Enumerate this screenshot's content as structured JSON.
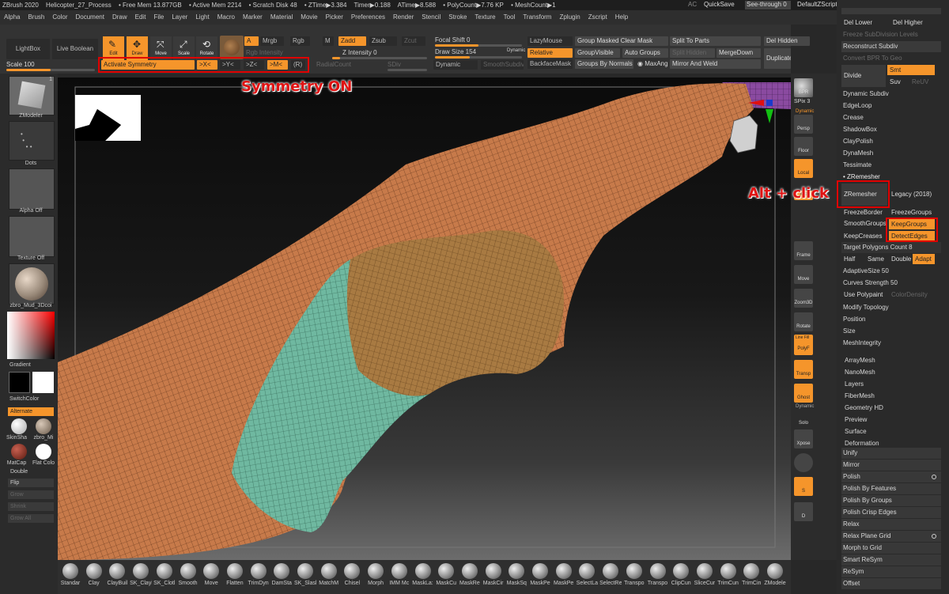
{
  "titlebar": {
    "items": [
      "ZBrush 2020",
      "Helicopter_27_Process",
      "• Free Mem 13.877GB",
      "• Active Mem 2214",
      "• Scratch Disk 48",
      "• ZTime▶3.384",
      "Timer▶0.188",
      "ATime▶8.588",
      "• PolyCount▶7.76 KP",
      "• MeshCount▶1"
    ],
    "ac": "AC",
    "quicksave": "QuickSave",
    "seethrough": "See-through  0",
    "defaultzscript": "DefaultZScript"
  },
  "menu": [
    "Alpha",
    "Brush",
    "Color",
    "Document",
    "Draw",
    "Edit",
    "File",
    "Layer",
    "Light",
    "Macro",
    "Marker",
    "Material",
    "Movie",
    "Picker",
    "Preferences",
    "Render",
    "Stencil",
    "Stroke",
    "Texture",
    "Tool",
    "Transform",
    "Zplugin",
    "Zscript",
    "Help"
  ],
  "shelf": {
    "lightbox": "LightBox",
    "liveboolean": "Live Boolean",
    "edit": "Edit",
    "draw": "Draw",
    "move": "Move",
    "scale": "Scale 100",
    "rotate": "Rotate",
    "a": "A",
    "mrgb": "Mrgb",
    "rgb": "Rgb",
    "m": "M",
    "zadd": "Zadd",
    "zsub": "Zsub",
    "zcut": "Zcut",
    "rgb_intensity": "Rgb Intensity",
    "z_intensity": "Z Intensity 0",
    "focal_shift": "Focal Shift 0",
    "draw_size": "Draw Size 154",
    "dynamic_label": "Dynamic",
    "dynamic": "Dynamic",
    "smoothsubdiv": "SmoothSubdiv",
    "activate_symmetry": "Activate Symmetry",
    "x": ">X<",
    "y": ">Y<",
    "z": ">Z<",
    "m_sym": ">M<",
    "r": "(R)",
    "radialcount": "RadialCount",
    "sdiv": "SDiv",
    "lazymouse": "LazyMouse",
    "relative": "Relative",
    "backfacemask": "BackfaceMask",
    "group_masked_clear_mask": "Group Masked Clear Mask",
    "groupvisible": "GroupVisible",
    "auto_groups": "Auto Groups",
    "groups_by_normals": "Groups By Normals",
    "maxang": "MaxAng",
    "mirror_and_weld": "Mirror And Weld",
    "split_to_parts": "Split To Parts",
    "split_hidden": "Split Hidden",
    "mergedown": "MergeDown",
    "del_hidden": "Del Hidden",
    "duplicate": "Duplicate"
  },
  "leftpanel": {
    "zmodeler": "ZModeler",
    "zmodeler_count": "1",
    "dots": "Dots",
    "alpha_off": "Alpha Off",
    "texture_off": "Texture Off",
    "material": "zbro_Mud_3Dcoi",
    "gradient": "Gradient",
    "switchcolor": "SwitchColor",
    "alternate": "Alternate",
    "skinshade": "SkinSha",
    "zbro_mi": "zbro_Mi",
    "matcap": "MatCap",
    "flat_color": "Flat Colo",
    "double": "Double",
    "flip": "Flip",
    "grow": "Grow",
    "shrink": "Shrink",
    "grow_all": "Grow All"
  },
  "annotations": {
    "symmetry": "Symmetry ON",
    "altclick": "Alt + click"
  },
  "righttools": {
    "bpr": "BPR",
    "spix": "SPix 3",
    "dynamic": "Dynamic",
    "persp": "Persp",
    "floor": "Floor",
    "local": "Local",
    "xyz": "Xyz",
    "frame": "Frame",
    "move": "Move",
    "zoom3d": "Zoom3D",
    "rotate": "Rotate",
    "linefill": "Line Fill",
    "polyf": "PolyF",
    "transp": "Transp",
    "ghost": "Ghost",
    "dynamic2": "Dynamic",
    "solo": "Solo",
    "xpose": "Xpose",
    "s": "S",
    "d": "D"
  },
  "rightpanel": {
    "top1": "Del Lower",
    "top2": "Del Higher",
    "freeze_subdiv": "Freeze SubDivision Levels",
    "reconstruct": "Reconstruct Subdiv",
    "convert_bpr": "Convert BPR To Geo",
    "divide": "Divide",
    "smt": "Smt",
    "suv": "Suv",
    "reuv": "ReUV",
    "dynamic_subdiv": "Dynamic Subdiv",
    "edgeloop": "EdgeLoop",
    "crease": "Crease",
    "shadowbox": "ShadowBox",
    "claypolish": "ClayPolish",
    "dynamesh": "DynaMesh",
    "tessimate": "Tessimate",
    "zremesher_header": "ZRemesher",
    "zremesher": "ZRemesher",
    "legacy": "Legacy (2018)",
    "freezeborder": "FreezeBorder",
    "freezegroups": "FreezeGroups",
    "smoothgroups": "SmoothGroups",
    "keepgroups": "KeepGroups",
    "keepcreases": "KeepCreases",
    "detectedges": "DetectEdges",
    "target_polygons": "Target Polygons Count 8",
    "half": "Half",
    "same": "Same",
    "double": "Double",
    "adapt": "Adapt",
    "adaptivesize": "AdaptiveSize 50",
    "curves_strength": "Curves Strength 50",
    "use_polypaint": "Use Polypaint",
    "colordensity": "ColorDensity",
    "modify_topology": "Modify Topology",
    "position": "Position",
    "size": "Size",
    "meshintegrity": "MeshIntegrity",
    "arraymesh": "ArrayMesh",
    "nanomesh": "NanoMesh",
    "layers": "Layers",
    "fibermesh": "FiberMesh",
    "geometry_hd": "Geometry HD",
    "preview": "Preview",
    "surface": "Surface",
    "deformation": "Deformation",
    "unify": "Unify",
    "mirror": "Mirror",
    "polish": "Polish",
    "polish_features": "Polish By Features",
    "polish_groups": "Polish By Groups",
    "polish_crisp": "Polish Crisp Edges",
    "relax": "Relax",
    "relax_plane": "Relax Plane Grid",
    "morph_grid": "Morph to Grid",
    "smart_resym": "Smart ReSym",
    "resym": "ReSym",
    "offset": "Offset"
  },
  "brushes": [
    "Standar",
    "Clay",
    "ClayBuil",
    "SK_Clayl",
    "SK_Clotl",
    "Smooth",
    "Move",
    "Flatten",
    "TrimDyn",
    "DamSta",
    "SK_Slasl",
    "MatchM",
    "Chisel",
    "Morph",
    "IMM Mc",
    "MaskLa:",
    "MaskCu",
    "MaskRe",
    "MaskCir",
    "MaskSq",
    "MaskPe",
    "MaskPe",
    "SelectLa",
    "SelectRe",
    "Transpo",
    "Transpo",
    "ClipCun",
    "SliceCur",
    "TrimCun",
    "TrimCin",
    "ZModele"
  ],
  "colors": {
    "orange": "#f5952b",
    "red": "#e00000",
    "mesh_orange": "#c77a4a",
    "mesh_teal": "#6fb8a0",
    "mesh_tan": "#a87a42"
  }
}
